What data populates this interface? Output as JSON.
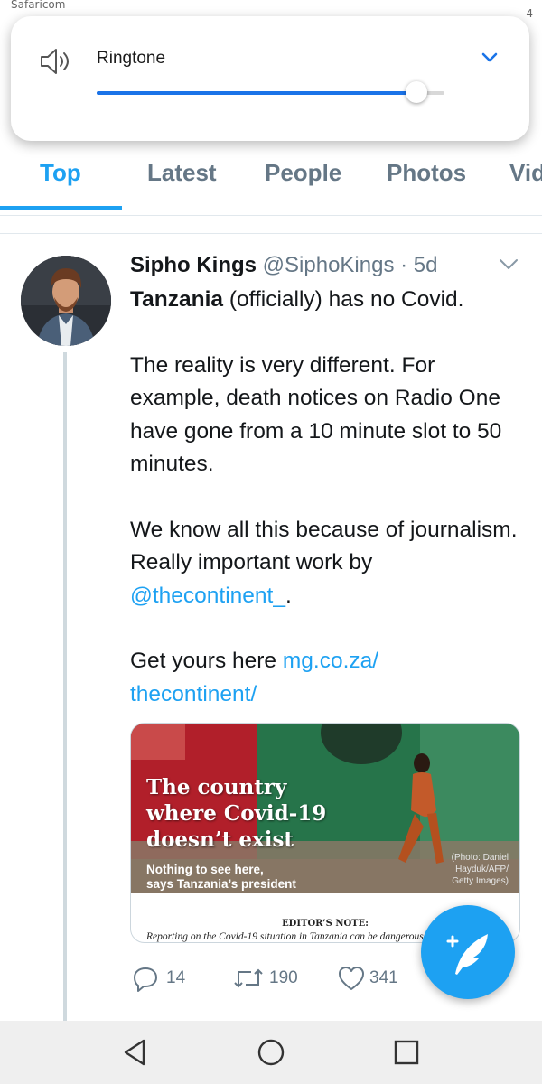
{
  "status_bar": {
    "carrier": "Safaricom",
    "time": "4"
  },
  "volume_panel": {
    "speaker_icon": "speaker-icon",
    "label": "Ringtone",
    "expand_icon": "chevron-down-icon",
    "level": 0.92,
    "accent_color": "#1a73e8"
  },
  "tabs": {
    "items": [
      "Top",
      "Latest",
      "People",
      "Photos",
      "Vid"
    ],
    "active": "Top",
    "accent_color": "#1da1f2"
  },
  "tweet": {
    "author_name": "Sipho Kings",
    "handle": "@SiphoKings",
    "separator": "·",
    "age": "5d",
    "line1_bold": "Tanzania",
    "line1_rest": " (officially) has no Covid.",
    "para2": "The reality is very different. For example, death notices on Radio One have gone from a 10 minute slot to 50 minutes.",
    "para3_text": "We know all this because of journalism. Really important work by ",
    "para3_mention": "@thecontinent_",
    "para3_end": ".",
    "para4_text": "Get yours here ",
    "para4_link_line1": "mg.co.za/",
    "para4_link_line2": "thecontinent/",
    "media": {
      "headline_line1": "The country",
      "headline_line2": "where Covid-19",
      "headline_line3": "doesn’t exist",
      "subline1": "Nothing to see here,",
      "subline2": "says Tanzania’s president",
      "credit_line1": "(Photo: Daniel",
      "credit_line2": "Hayduk/AFP/",
      "credit_line3": "Getty Images)",
      "editor_note": "EDITOR’S NOTE:",
      "excerpt": "Reporting on the Covid-19 situation in Tanzania can be dangerous"
    },
    "actions": {
      "replies": "14",
      "retweets": "190",
      "likes": "341"
    }
  },
  "fab": {
    "icon": "compose-feather-icon"
  }
}
